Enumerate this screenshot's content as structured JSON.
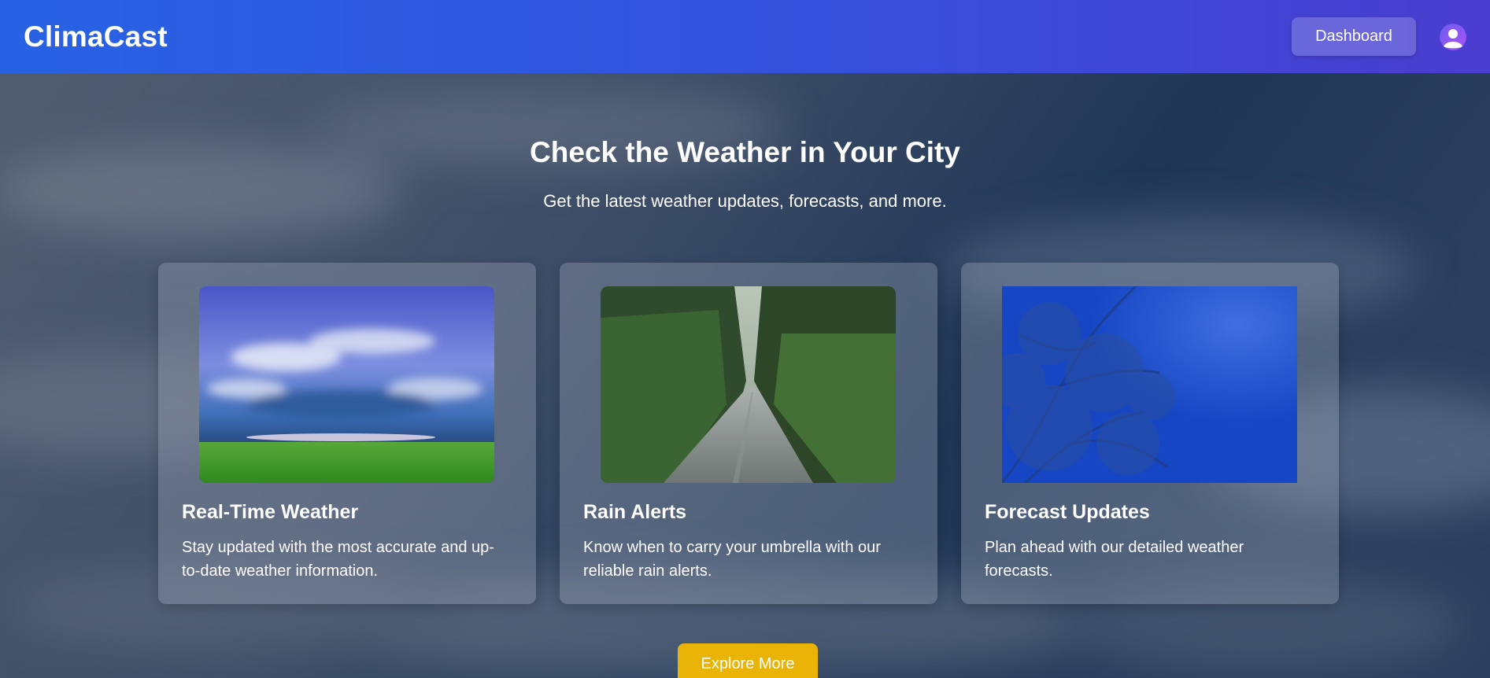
{
  "header": {
    "brand": "ClimaCast",
    "dashboard_label": "Dashboard"
  },
  "hero": {
    "title": "Check the Weather in Your City",
    "subtitle": "Get the latest weather updates, forecasts, and more."
  },
  "cards": [
    {
      "title": "Real-Time Weather",
      "text": "Stay updated with the most accurate and up-to-date weather information."
    },
    {
      "title": "Rain Alerts",
      "text": "Know when to carry your umbrella with our reliable rain alerts."
    },
    {
      "title": "Forecast Updates",
      "text": "Plan ahead with our detailed weather forecasts."
    }
  ],
  "cta": {
    "explore_label": "Explore More"
  },
  "colors": {
    "header_start": "#2862e4",
    "header_end": "#4a3dcf",
    "cta": "#eab308"
  }
}
